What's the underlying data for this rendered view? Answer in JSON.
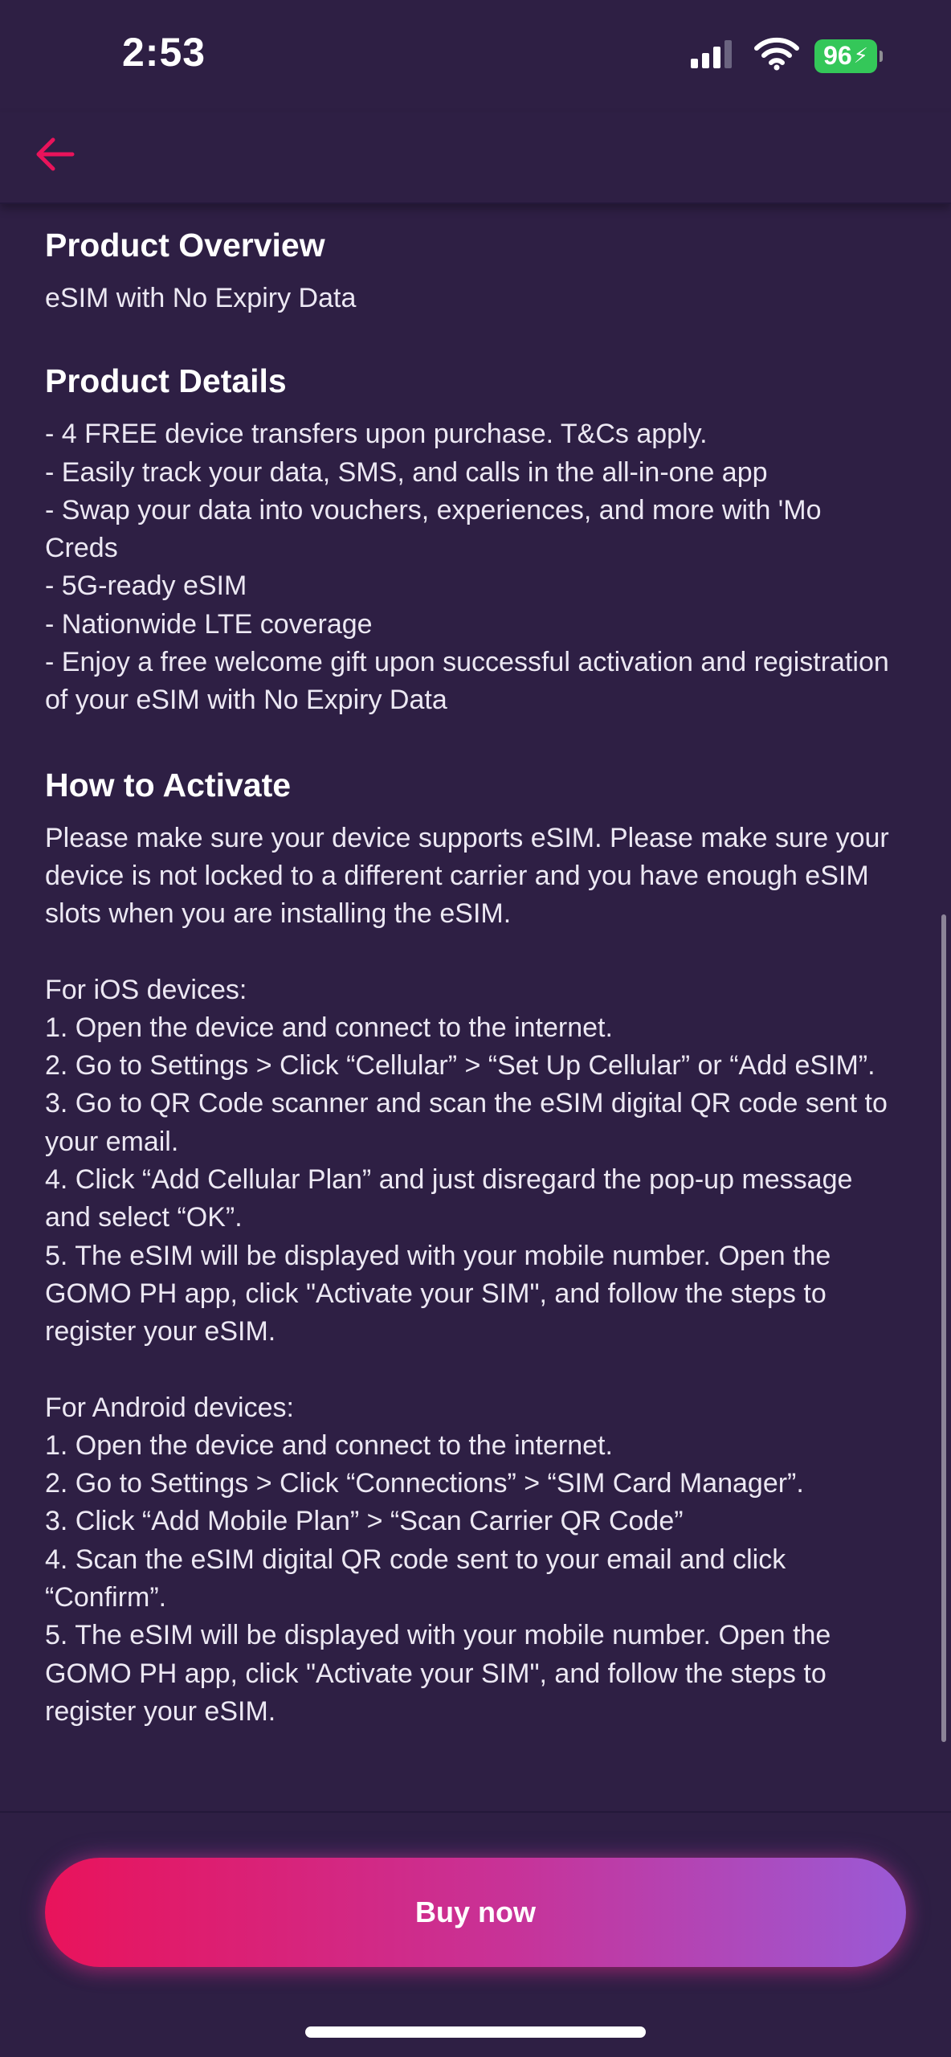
{
  "status_bar": {
    "time": "2:53",
    "battery": "96"
  },
  "overview": {
    "title": "Product Overview",
    "text": "eSIM with No Expiry Data"
  },
  "details": {
    "title": "Product Details",
    "lines": [
      "- 4 FREE device transfers upon purchase. T&Cs apply.",
      "- Easily track your data, SMS, and calls in the all-in-one app",
      "- Swap your data into vouchers, experiences, and more with 'Mo Creds",
      "- 5G-ready eSIM",
      "- Nationwide LTE coverage",
      "- Enjoy a free welcome gift upon successful activation and registration of your eSIM with No Expiry Data"
    ]
  },
  "activate": {
    "title": "How to Activate",
    "intro": "Please make sure your device supports eSIM. Please make sure your device is not locked to a different carrier and you have enough eSIM slots when you are installing the eSIM.",
    "ios_heading": "For iOS devices:",
    "ios_steps": [
      "1. Open the device and connect to the internet.",
      "2. Go to Settings > Click “Cellular” > “Set Up Cellular” or “Add eSIM”.",
      "3. Go to QR Code scanner and scan the eSIM digital QR code sent to your email.",
      "4. Click “Add Cellular Plan” and just disregard the pop-up message and select “OK”.",
      "5. The eSIM will be displayed with your mobile number. Open the GOMO PH app, click \"Activate your SIM\", and follow the steps to register your eSIM."
    ],
    "android_heading": "For Android devices:",
    "android_steps": [
      "1. Open the device and connect to the internet.",
      "2. Go to Settings > Click “Connections” > “SIM Card Manager”.",
      "3. Click “Add Mobile Plan” > “Scan Carrier QR Code”",
      "4. Scan the eSIM digital QR code sent to your email and click “Confirm”.",
      "5. The eSIM will be displayed with your mobile number. Open the GOMO PH app, click \"Activate your SIM\", and follow the steps to register your eSIM."
    ]
  },
  "footer": {
    "buy_label": "Buy now"
  },
  "colors": {
    "background": "#2e1f44",
    "accent": "#e9135b",
    "gradient_end": "#9a5ad6"
  },
  "icons": {
    "back": "arrow-left-icon",
    "signal": "cellular-signal-icon",
    "wifi": "wifi-icon",
    "battery": "battery-charging-icon"
  }
}
